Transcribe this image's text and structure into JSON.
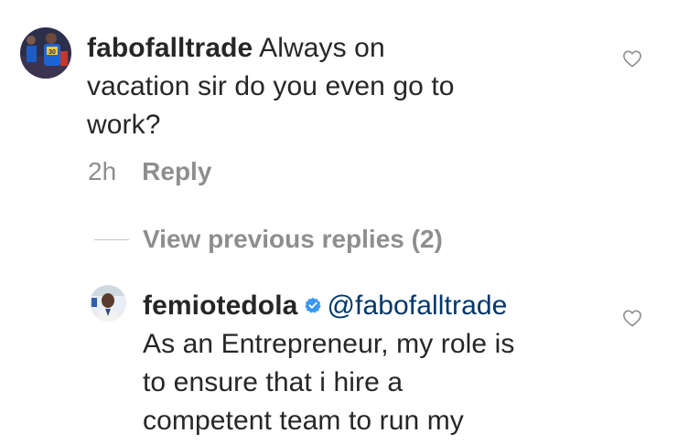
{
  "comment1": {
    "username": "fabofalltrade",
    "lines": [
      "Always on",
      "vacation sir do you even go to",
      "work?"
    ],
    "time": "2h",
    "reply_label": "Reply",
    "avatar_jersey_number": "30"
  },
  "view_replies": {
    "label": "View previous replies (2)"
  },
  "comment2": {
    "username": "femiotedola",
    "mention": "@fabofalltrade",
    "lines": [
      "As an Entrepreneur, my role is",
      "to ensure that i hire a",
      "competent team to run my"
    ]
  },
  "icons": {
    "like": "heart-outline-icon",
    "verified": "verified-badge-icon"
  },
  "colors": {
    "text": "#262626",
    "secondary": "#8e8e8e",
    "mention": "#00376b",
    "verified": "#3897f0",
    "divider": "#c7c7c7"
  }
}
